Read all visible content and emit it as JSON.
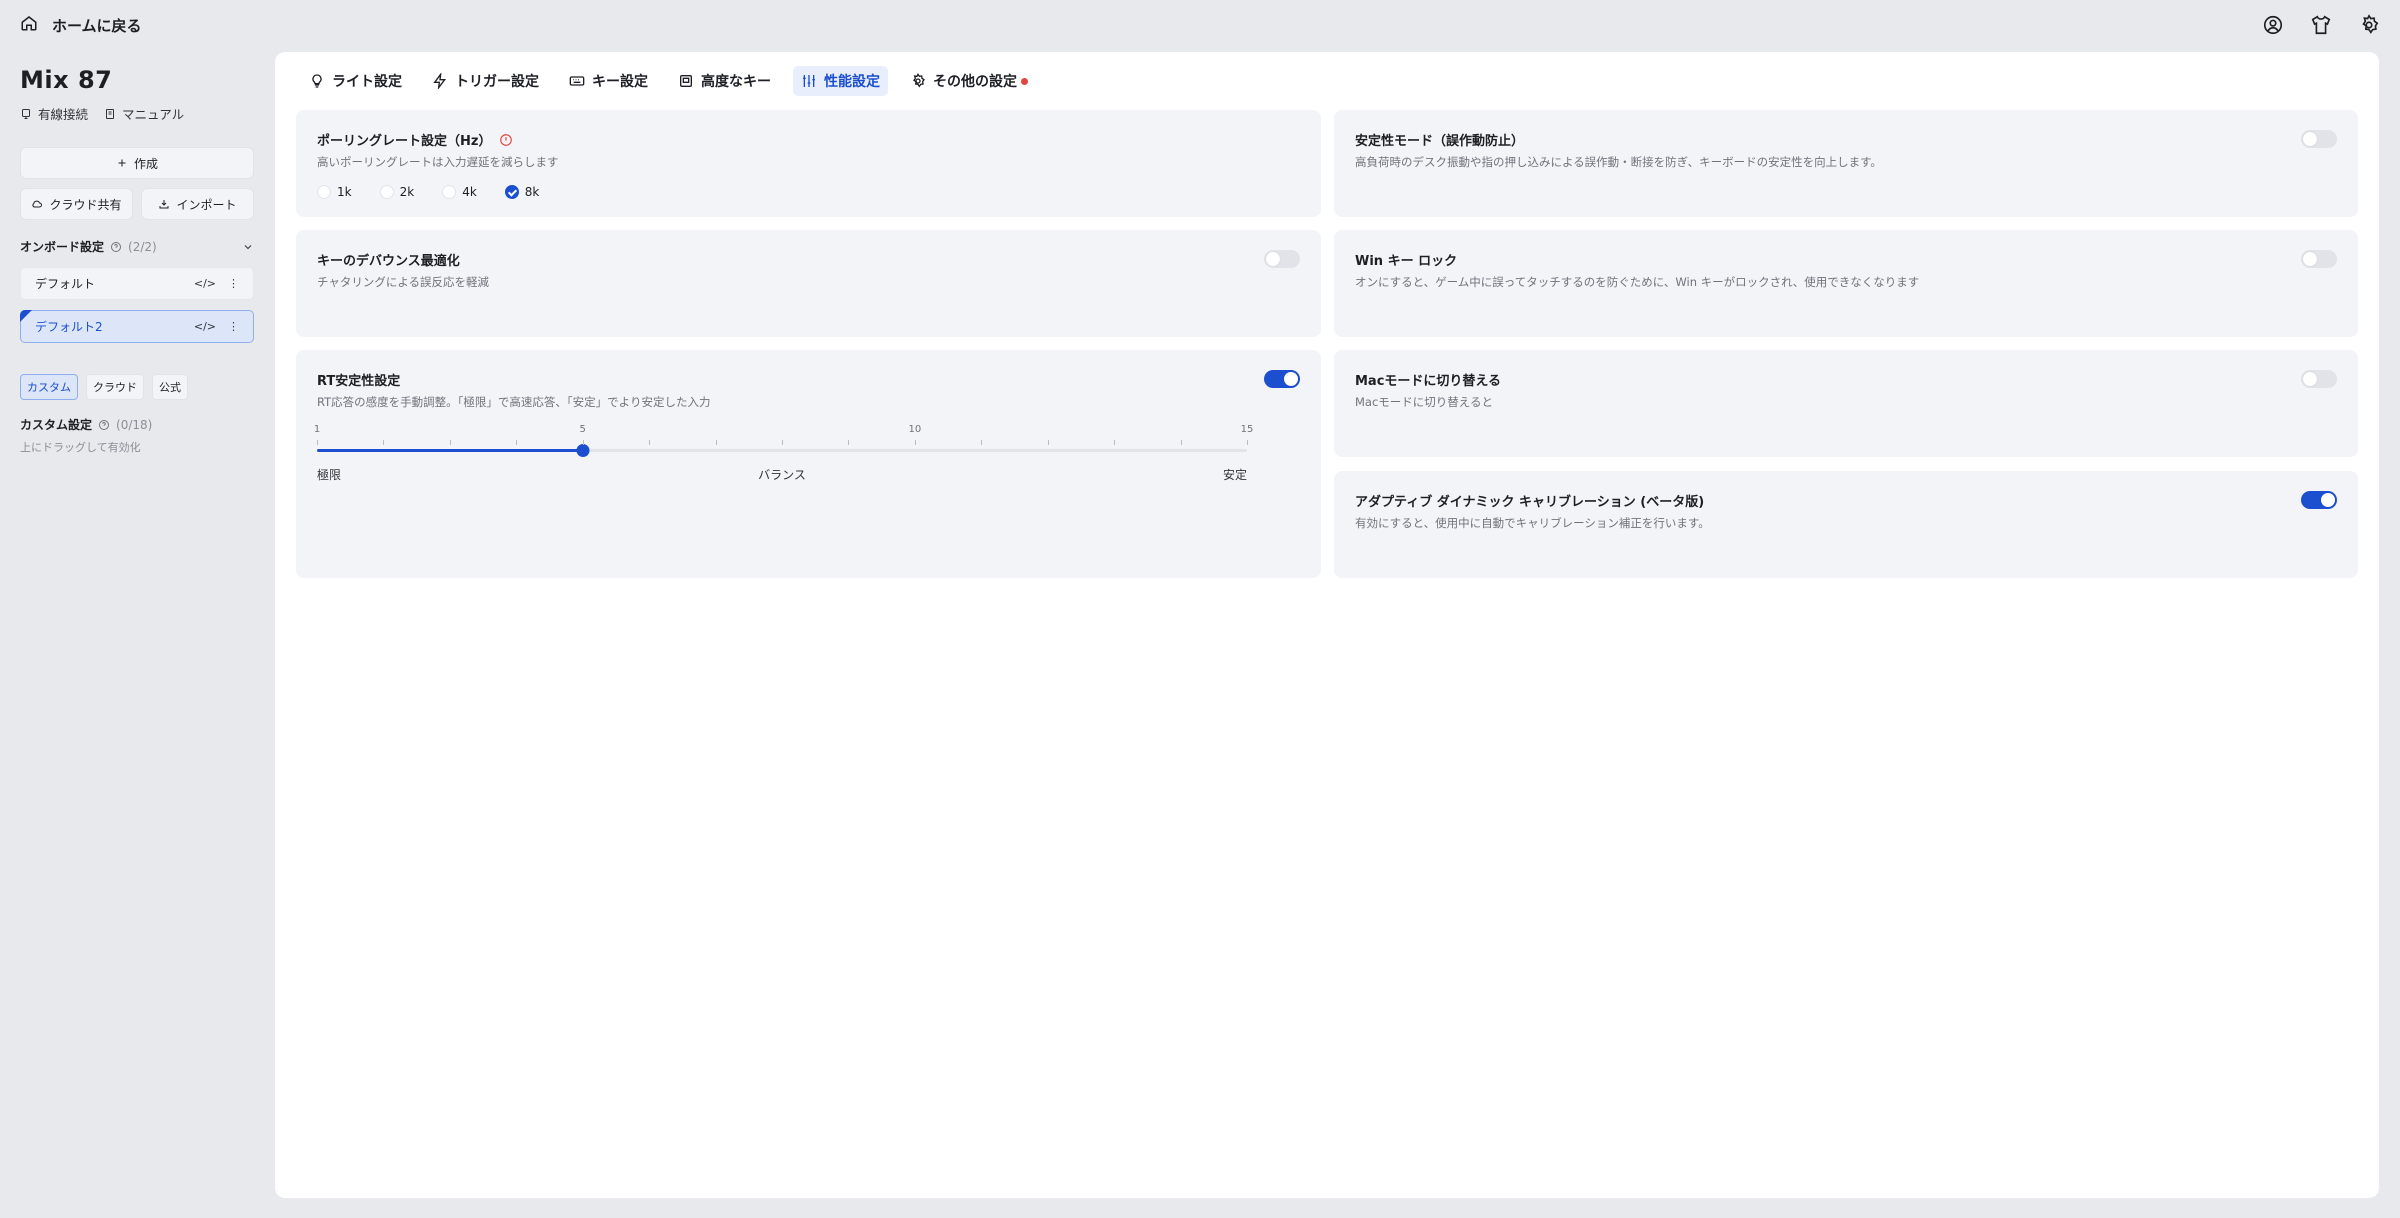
{
  "header": {
    "home_label": "ホームに戻る"
  },
  "device": {
    "name": "Mix 87",
    "connection": "有線接続",
    "manual": "マニュアル"
  },
  "sidebar": {
    "create_label": "作成",
    "cloud_share_label": "クラウド共有",
    "import_label": "インポート",
    "onboard_title": "オンボード設定",
    "onboard_count": "(2/2)",
    "profiles": [
      {
        "name": "デフォルト"
      },
      {
        "name": "デフォルト2"
      }
    ],
    "segments": [
      "カスタム",
      "クラウド",
      "公式"
    ],
    "custom_title": "カスタム設定",
    "custom_count": "(0/18)",
    "custom_hint": "上にドラッグして有効化"
  },
  "tabs": [
    {
      "label": "ライト設定"
    },
    {
      "label": "トリガー設定"
    },
    {
      "label": "キー設定"
    },
    {
      "label": "高度なキー"
    },
    {
      "label": "性能設定"
    },
    {
      "label": "その他の設定"
    }
  ],
  "cards": {
    "polling": {
      "title": "ポーリングレート設定（Hz）",
      "desc": "高いポーリングレートは入力遅延を減らします",
      "options": [
        "1k",
        "2k",
        "4k",
        "8k"
      ],
      "selected": "8k"
    },
    "stability": {
      "title": "安定性モード（誤作動防止）",
      "desc": "高負荷時のデスク振動や指の押し込みによる誤作動・断接を防ぎ、キーボードの安定性を向上します。",
      "enabled": false
    },
    "debounce": {
      "title": "キーのデバウンス最適化",
      "desc": "チャタリングによる誤反応を軽減",
      "enabled": false
    },
    "winlock": {
      "title": "Win キー ロック",
      "desc": "オンにすると、ゲーム中に誤ってタッチするのを防ぐために、Win キーがロックされ、使用できなくなります",
      "enabled": false
    },
    "rt": {
      "title": "RT安定性設定",
      "desc": "RT応答の感度を手動調整。「極限」で高速応答、「安定」でより安定した入力",
      "enabled": true,
      "min": 1,
      "max": 15,
      "value": 5,
      "tick_labels": [
        "1",
        "5",
        "10",
        "15"
      ],
      "scale_left": "極限",
      "scale_mid": "バランス",
      "scale_right": "安定"
    },
    "mac": {
      "title": "Macモードに切り替える",
      "desc": "Macモードに切り替えると",
      "enabled": false
    },
    "adc": {
      "title": "アダプティブ ダイナミック キャリブレーション (ベータ版)",
      "desc": "有効にすると、使用中に自動でキャリブレーション補正を行います。",
      "enabled": true
    }
  },
  "colors": {
    "accent": "#1b4fd0",
    "notify_dot": "#e2443f"
  }
}
